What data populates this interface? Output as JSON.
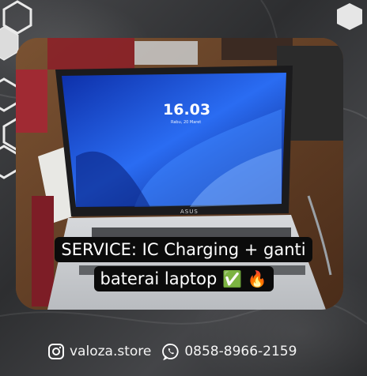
{
  "laptop_screen": {
    "time": "16.03",
    "date": "Rabu, 20 Maret",
    "brand": "ASUS"
  },
  "caption": {
    "line1": "SERVICE: IC Charging + ganti",
    "line2": "baterai laptop",
    "emoji_check": "✅",
    "emoji_fire": "🔥"
  },
  "footer": {
    "instagram_icon": "instagram-icon",
    "instagram_handle": "valoza.store",
    "whatsapp_icon": "whatsapp-icon",
    "phone": "0858-8966-2159"
  },
  "colors": {
    "background": "#3b3c3e",
    "caption_bg": "#0b0b0b",
    "screen_blue": "#1d4fd6",
    "check_green": "#3cb043"
  }
}
